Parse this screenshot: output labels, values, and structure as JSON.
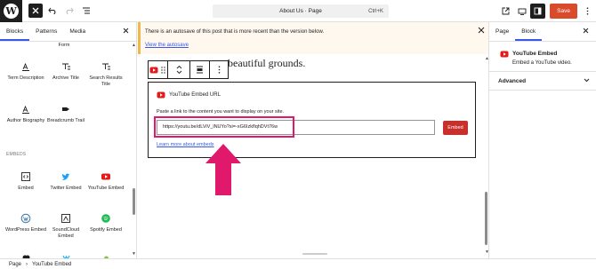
{
  "app": {
    "logo_letter": "W",
    "save_label": "Save",
    "accent_color": "#3858e9",
    "save_color": "#d94b2b"
  },
  "command_bar": {
    "title": "About Us · Page",
    "shortcut": "Ctrl+K"
  },
  "left_panel": {
    "tabs": [
      "Blocks",
      "Patterns",
      "Media"
    ],
    "top_partial": "Form",
    "blocks_row1": [
      {
        "label": "Term Description",
        "icon": "term-description-icon"
      },
      {
        "label": "Archive Title",
        "icon": "archive-title-icon"
      },
      {
        "label": "Search Results Title",
        "icon": "search-results-title-icon"
      }
    ],
    "blocks_row2": [
      {
        "label": "Author Biography",
        "icon": "author-biography-icon"
      },
      {
        "label": "Breadcrumb Trail",
        "icon": "breadcrumb-trail-icon"
      }
    ],
    "section_embeds": "EMBEDS",
    "embeds_row1": [
      {
        "label": "Embed",
        "icon": "embed-icon"
      },
      {
        "label": "Twitter Embed",
        "icon": "twitter-icon"
      },
      {
        "label": "YouTube Embed",
        "icon": "youtube-icon"
      }
    ],
    "embeds_row2": [
      {
        "label": "WordPress Embed",
        "icon": "wordpress-icon"
      },
      {
        "label": "SoundCloud Embed",
        "icon": "soundcloud-icon"
      },
      {
        "label": "Spotify Embed",
        "icon": "spotify-icon"
      }
    ]
  },
  "notice": {
    "message": "There is an autosave of this post that is more recent than the version below.",
    "link": "View the autosave"
  },
  "editor": {
    "paragraph_fragment": "beautiful grounds.",
    "embed_title": "YouTube Embed URL",
    "embed_description": "Paste a link to the content you want to display on your site.",
    "url_value": "https://youtu.be/dLViV_lNUYo?si=-xG6IzkflqhDVt76w",
    "embed_button": "Embed",
    "learn_more": "Learn more about embeds"
  },
  "right_panel": {
    "tabs": [
      "Page",
      "Block"
    ],
    "block_name": "YouTube Embed",
    "block_desc": "Embed a YouTube video.",
    "advanced_label": "Advanced"
  },
  "breadcrumb": {
    "items": [
      "Page",
      "YouTube Embed"
    ]
  }
}
